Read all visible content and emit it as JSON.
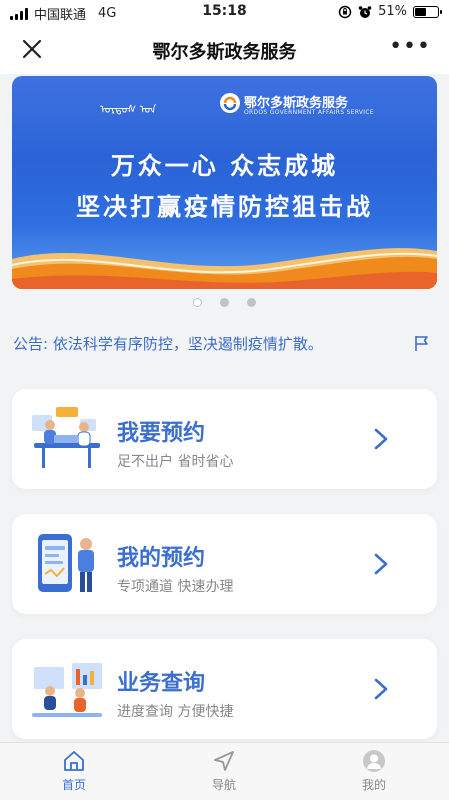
{
  "status_bar": {
    "carrier": "中国联通",
    "network": "4G",
    "time": "15:18",
    "battery": "51%",
    "battery_level": 0.51
  },
  "nav": {
    "title": "鄂尔多斯政务服务"
  },
  "banner": {
    "mongolian_text": "ᠣᠷᠳᠣᠰ ᠤᠨ",
    "brand": "鄂尔多斯政务服务",
    "brand_en": "ORDOS GOVERNMENT AFFAIRS SERVICE",
    "line1": "万众一心 众志成城",
    "line2": "坚决打赢疫情防控狙击战",
    "slide_count": 3,
    "active_slide": 1
  },
  "notice": {
    "text": "公告: 依法科学有序防控，坚决遏制疫情扩散。"
  },
  "cards": [
    {
      "title": "我要预约",
      "subtitle": "足不出户 省时省心"
    },
    {
      "title": "我的预约",
      "subtitle": "专项通道 快速办理"
    },
    {
      "title": "业务查询",
      "subtitle": "进度查询 方便快捷"
    }
  ],
  "tabs": [
    {
      "label": "首页",
      "icon": "home-icon",
      "active": true
    },
    {
      "label": "导航",
      "icon": "navigation-icon",
      "active": false
    },
    {
      "label": "我的",
      "icon": "profile-icon",
      "active": false
    }
  ],
  "colors": {
    "accent": "#3a6fd1",
    "banner_blue": "#2a63d6",
    "banner_orange": "#f08a1c"
  }
}
